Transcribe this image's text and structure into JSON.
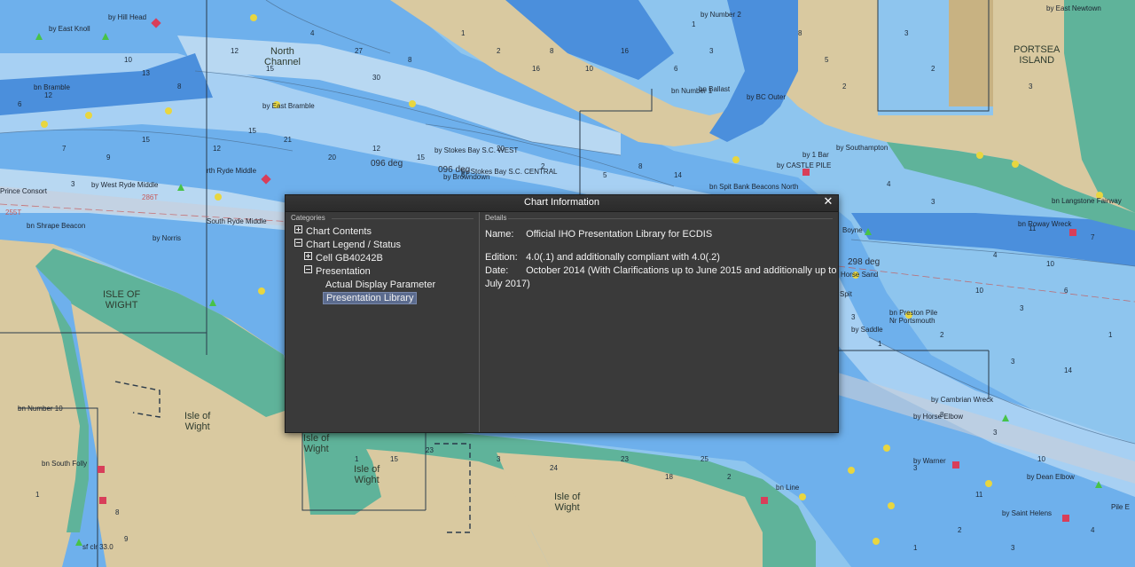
{
  "map": {
    "labels": {
      "north_channel": "North\nChannel",
      "isle_of_wight_1": "ISLE OF\nWIGHT",
      "isle_of_wight_2": "Isle of\nWight",
      "isle_of_wight_3": "Isle of\nWight",
      "isle_of_wight_4": "Isle of\nWight",
      "isle_of_wight_5": "Isle of\nWight",
      "portsea_island": "PORTSEA\nISLAND",
      "by_hill_head": "by Hill Head",
      "by_east_knoll": "by East Knoll",
      "by_east_bramble": "by East Bramble",
      "by_bramble": "bn Bramble",
      "by_west_ryde_middle": "by West Ryde Middle",
      "north_ryde_middle": "rth Ryde Middle",
      "south_ryde_middle": "South Ryde Middle",
      "by_norris": "by Norris",
      "bn_shrape_beacon": "bn Shrape Beacon",
      "prince_consort": "Prince Consort",
      "by_stokes_bay_sc_west": "by Stokes Bay S.C. WEST",
      "by_stokes_bay_sc_central": "by Stokes Bay S.C. CENTRAL",
      "by_browndown": "by Browndown",
      "heading_096_1": "096 deg",
      "heading_096_2": "096 deg",
      "heading_286": "286T",
      "heading_255": "255T",
      "heading_298": "298 deg",
      "bn_spit_bank": "bn Spit Bank Beacons North",
      "by_southampton": "by Southampton",
      "by_castle_pile": "by CASTLE PILE",
      "by_1_bar": "by 1 Bar",
      "bn_ballast": "bn Ballast",
      "bn_number_1": "bn Number 1",
      "by_bc_outer": "by BC Outer",
      "by_langstone_fairway": "bn Langstone Fairway",
      "by_roway_wreck": "bn Roway Wreck",
      "by_horse_sand": "Horse Sand",
      "by_boyne": "Boyne",
      "bn_preston_pile": "bn Preston Pile\nNr Portsmouth",
      "by_saddle": "by Saddle",
      "by_cambrian_wreck": "by Cambrian Wreck",
      "by_horse_elbow": "by Horse Elbow",
      "by_warner": "by Warner",
      "by_dean_elbow": "by Dean Elbow",
      "by_saint_helens": "by Saint Helens",
      "bn_number_10": "bn Number 10",
      "bn_south_folly": "bn South Folly",
      "bn_line": "bn Line",
      "by_east_knoll_2": "by East Knoll",
      "sf_clr": "sf clr 33.0",
      "by_east_newtown": "by East Newtown",
      "by_number_2": "by Number 2",
      "spit": "Spit",
      "pile_e": "Pile E"
    }
  },
  "dialog": {
    "title": "Chart Information",
    "close_icon": "close-icon",
    "categories_title": "Categories",
    "details_title": "Details",
    "tree": [
      {
        "label": "Chart Contents",
        "expander": "plus"
      },
      {
        "label": "Chart Legend / Status",
        "expander": "minus"
      },
      {
        "label": "Cell GB40242B",
        "expander": "plus"
      },
      {
        "label": "Presentation",
        "expander": "minus"
      },
      {
        "label": "Actual Display Parameter",
        "expander": "none"
      },
      {
        "label": "Presentation Library",
        "expander": "none",
        "selected": true
      }
    ],
    "details": {
      "name_label": "Name:",
      "name_value": "Official IHO Presentation Library for ECDIS",
      "edition_label": "Edition:",
      "edition_value": "4.0(.1) and additionally compliant with 4.0(.2)",
      "date_label": "Date:",
      "date_value_line1": "October 2014 (With Clarifications up to June 2015 and additionally up to",
      "date_value_line2": "July 2017)"
    }
  },
  "colors": {
    "deep_water": "#8ec5ee",
    "medium_water": "#5e9fe6",
    "shallow_water": "#b8d8f2",
    "land": "#d9c9a0",
    "drying": "#5fb39a",
    "dialog_bg": "#3a3a3a",
    "selection": "#5b6b8e"
  }
}
